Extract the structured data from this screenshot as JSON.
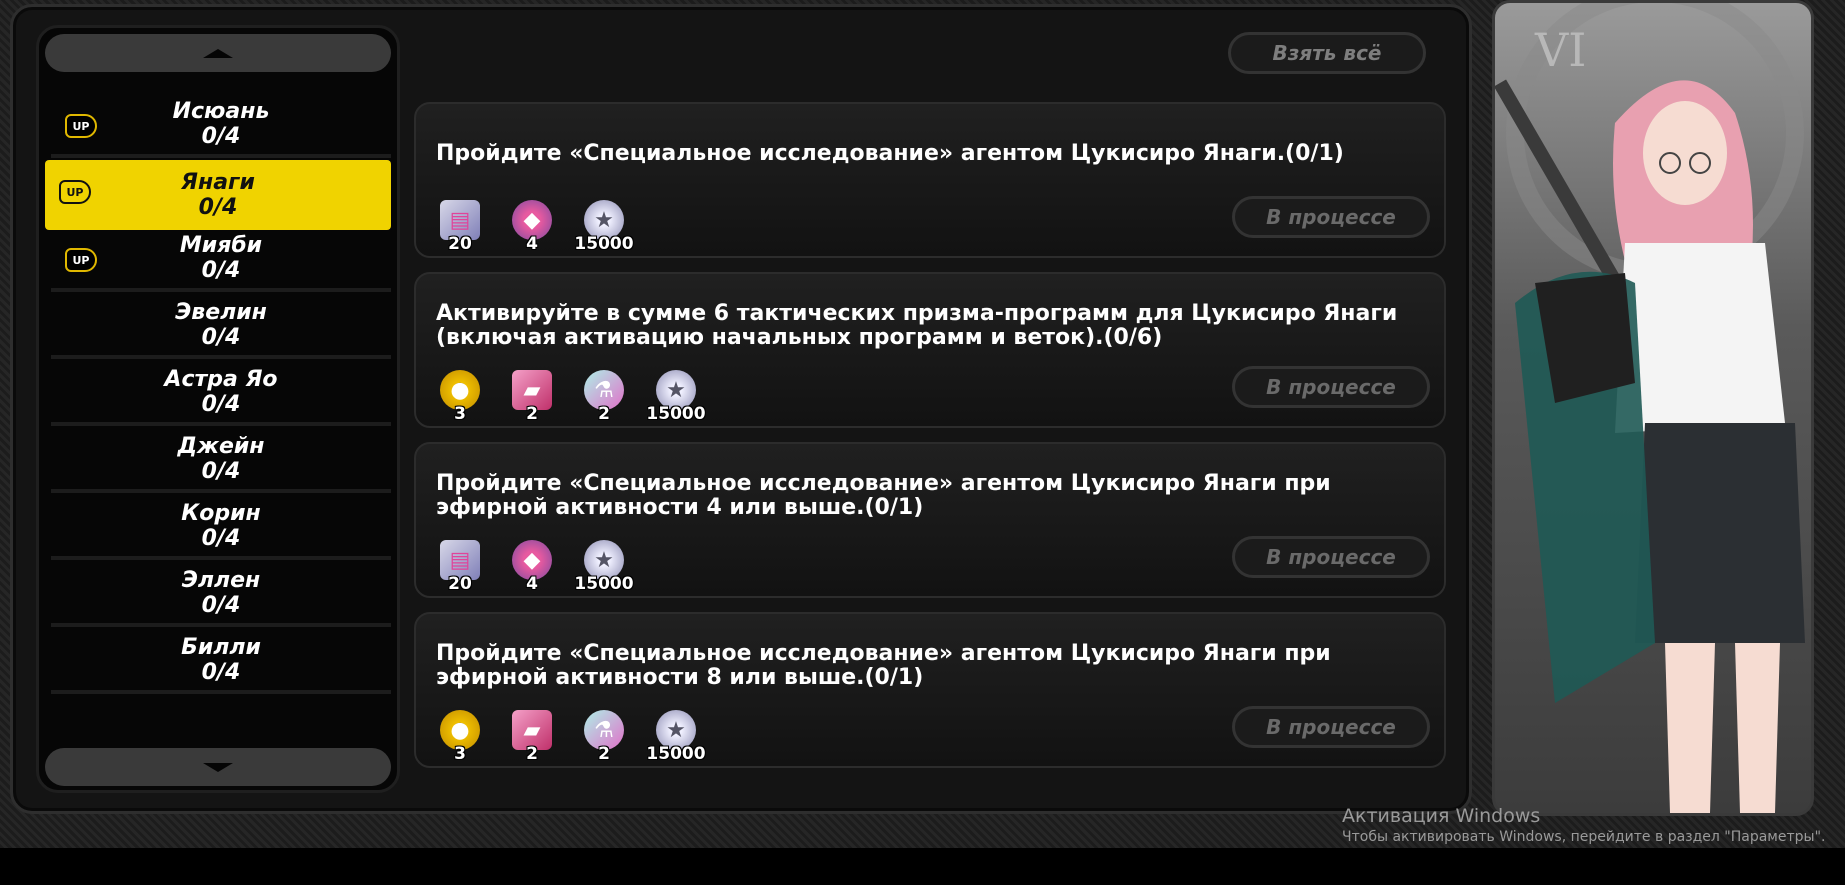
{
  "sidebar": {
    "agents": [
      {
        "name": "Исюань",
        "progress": "0/4",
        "badge": "UP"
      },
      {
        "name": "Янаги",
        "progress": "0/4",
        "badge": "UP"
      },
      {
        "name": "Мияби",
        "progress": "0/4",
        "badge": "UP"
      },
      {
        "name": "Эвелин",
        "progress": "0/4"
      },
      {
        "name": "Астра Яо",
        "progress": "0/4"
      },
      {
        "name": "Джейн",
        "progress": "0/4"
      },
      {
        "name": "Корин",
        "progress": "0/4"
      },
      {
        "name": "Эллен",
        "progress": "0/4"
      },
      {
        "name": "Билли",
        "progress": "0/4"
      }
    ]
  },
  "claim_all_label": "Взять всё",
  "tasks": [
    {
      "text": "Пройдите «Специальное исследование» агентом Цукисиро Янаги.(0/1)",
      "status": "В процессе",
      "rewards": [
        {
          "icon": "film-reel-icon",
          "count": "20"
        },
        {
          "icon": "car-icon",
          "count": "4"
        },
        {
          "icon": "denny-coin-icon",
          "count": "15000"
        }
      ]
    },
    {
      "text": "Активируйте в сумме 6 тактических призма-программ для Цукисиро Янаги (включая активацию начальных программ и веток).(0/6)",
      "status": "В процессе",
      "rewards": [
        {
          "icon": "disc-icon",
          "count": "3"
        },
        {
          "icon": "card-icon",
          "count": "2"
        },
        {
          "icon": "bottle-icon",
          "count": "2"
        },
        {
          "icon": "denny-coin-icon",
          "count": "15000"
        }
      ]
    },
    {
      "text": "Пройдите «Специальное исследование» агентом Цукисиро Янаги при эфирной активности 4 или выше.(0/1)",
      "status": "В процессе",
      "rewards": [
        {
          "icon": "film-reel-icon",
          "count": "20"
        },
        {
          "icon": "car-icon",
          "count": "4"
        },
        {
          "icon": "denny-coin-icon",
          "count": "15000"
        }
      ]
    },
    {
      "text": "Пройдите «Специальное исследование» агентом Цукисиро Янаги при эфирной активности 8 или выше.(0/1)",
      "status": "В процессе",
      "rewards": [
        {
          "icon": "disc-icon",
          "count": "3"
        },
        {
          "icon": "card-icon",
          "count": "2"
        },
        {
          "icon": "bottle-icon",
          "count": "2"
        },
        {
          "icon": "denny-coin-icon",
          "count": "15000"
        }
      ]
    }
  ],
  "character_panel": {
    "clock_numeral": "VI"
  },
  "watermark": {
    "title": "Активация Windows",
    "subtitle": "Чтобы активировать Windows, перейдите в раздел \"Параметры\"."
  },
  "colors": {
    "accent": "#f0d300",
    "background": "#141414"
  }
}
